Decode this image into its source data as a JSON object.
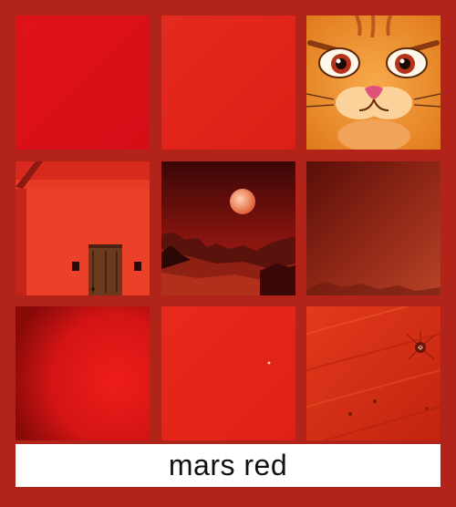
{
  "caption": "mars red",
  "colors": {
    "background": "#b2231a",
    "swatch_flat": "#e0151c",
    "swatch_light": "#e3251c",
    "caption_bg": "#ffffff"
  },
  "tiles": [
    {
      "subject": "flat-red-swatch"
    },
    {
      "subject": "light-red-swatch"
    },
    {
      "subject": "angry-orange-cat-face"
    },
    {
      "subject": "red-house-with-door"
    },
    {
      "subject": "red-moon-over-desert"
    },
    {
      "subject": "dark-red-gradient"
    },
    {
      "subject": "deep-red-gradient"
    },
    {
      "subject": "red-texture"
    },
    {
      "subject": "red-wood-surface"
    }
  ]
}
